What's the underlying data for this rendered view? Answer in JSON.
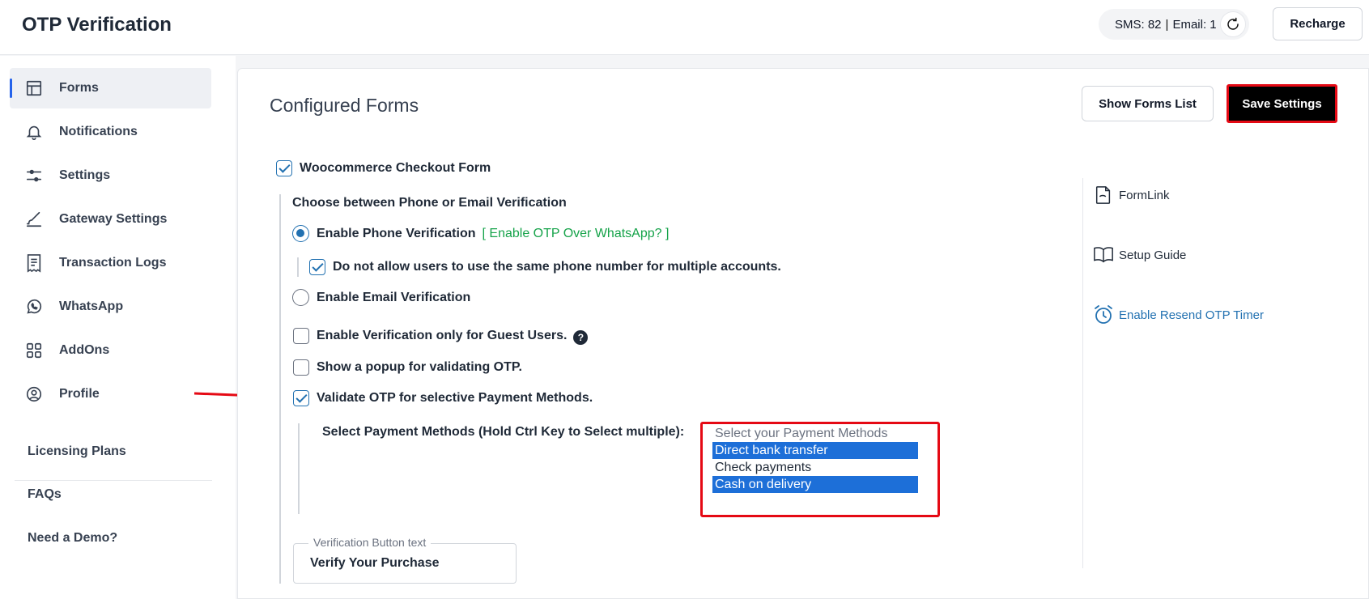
{
  "header": {
    "title": "OTP Verification",
    "sms_label": "SMS: 82",
    "separator": "|",
    "email_label": "Email: 1",
    "recharge_label": "Recharge"
  },
  "sidebar": {
    "items": [
      {
        "label": "Forms",
        "icon": "layout-icon",
        "active": true
      },
      {
        "label": "Notifications",
        "icon": "bell-icon"
      },
      {
        "label": "Settings",
        "icon": "sliders-icon"
      },
      {
        "label": "Gateway Settings",
        "icon": "brush-icon"
      },
      {
        "label": "Transaction Logs",
        "icon": "receipt-icon"
      },
      {
        "label": "WhatsApp",
        "icon": "whatsapp-icon"
      },
      {
        "label": "AddOns",
        "icon": "grid-icon"
      },
      {
        "label": "Profile",
        "icon": "user-circle-icon"
      }
    ],
    "links": [
      "Licensing Plans",
      "FAQs",
      "Need a Demo?"
    ]
  },
  "main": {
    "title": "Configured Forms",
    "show_forms_label": "Show Forms List",
    "save_label": "Save Settings",
    "form_name": "Woocommerce Checkout Form",
    "choose_label": "Choose between Phone or Email Verification",
    "phone_label": "Enable Phone Verification",
    "whatsapp_link": "[ Enable OTP Over WhatsApp? ]",
    "same_phone_label": "Do not allow users to use the same phone number for multiple accounts.",
    "email_label": "Enable Email Verification",
    "guest_label": "Enable Verification only for Guest Users.",
    "help_glyph": "?",
    "popup_label": "Show a popup for validating OTP.",
    "payment_label": "Validate OTP for selective Payment Methods.",
    "select_pm_label": "Select Payment Methods (Hold Ctrl Key to Select multiple):",
    "pm_placeholder": "Select your Payment Methods",
    "pm_options": [
      {
        "label": "Direct bank transfer",
        "selected": true
      },
      {
        "label": "Check payments",
        "selected": false
      },
      {
        "label": "Cash on delivery",
        "selected": true
      }
    ],
    "vb_legend": "Verification Button text",
    "vb_value": "Verify Your Purchase"
  },
  "right_panel": {
    "formlink": "FormLink",
    "setup_guide": "Setup Guide",
    "resend_timer": "Enable Resend OTP Timer"
  },
  "colors": {
    "accent": "#2271b1",
    "highlight": "#e50914",
    "selected_option": "#1d6fd8",
    "whatsapp_link": "#16a34a"
  }
}
